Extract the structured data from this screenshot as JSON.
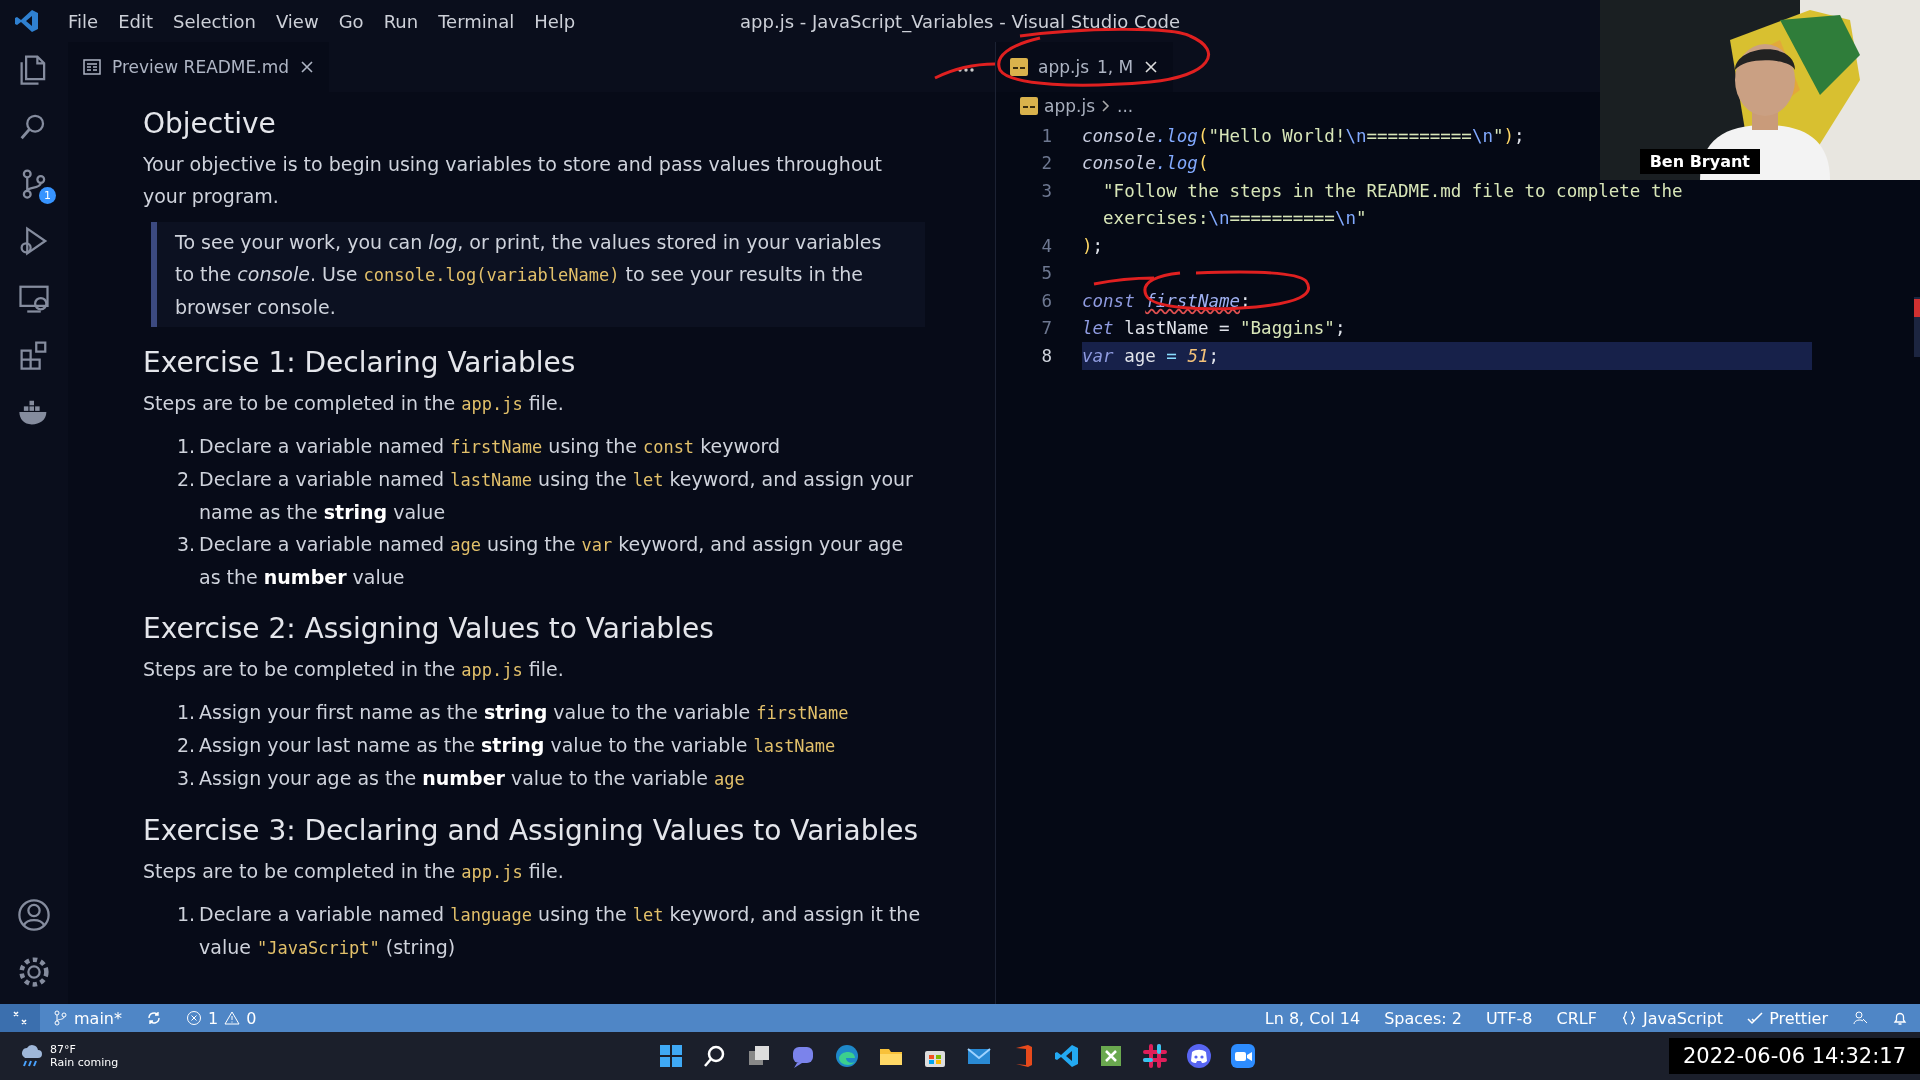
{
  "title_bar": {
    "menu": [
      "File",
      "Edit",
      "Selection",
      "View",
      "Go",
      "Run",
      "Terminal",
      "Help"
    ],
    "title": "app.js - JavaScript_Variables - Visual Studio Code"
  },
  "activity_bar": {
    "top": [
      {
        "kind": "files",
        "selected": false
      },
      {
        "kind": "search",
        "selected": false
      },
      {
        "kind": "scm",
        "selected": false,
        "badge": "1"
      },
      {
        "kind": "debug",
        "selected": false
      },
      {
        "kind": "remote",
        "selected": false
      },
      {
        "kind": "extensions",
        "selected": false
      },
      {
        "kind": "docker",
        "selected": false
      }
    ],
    "bottom": [
      {
        "kind": "account"
      },
      {
        "kind": "settings"
      }
    ]
  },
  "preview": {
    "tab": {
      "label": "Preview README.md",
      "selected": true
    },
    "blocks": [
      {
        "kind": "h2",
        "text": "Objective"
      },
      {
        "kind": "p",
        "segments": [
          {
            "kind": "text",
            "text": "Your objective is to begin using variables to store and pass values throughout your program."
          }
        ]
      },
      {
        "kind": "quote",
        "segments": [
          {
            "kind": "text",
            "text": "To see your work, you can "
          },
          {
            "kind": "italic",
            "text": "log"
          },
          {
            "kind": "text",
            "text": ", or print, the values stored in your variables to the "
          },
          {
            "kind": "italic",
            "text": "console"
          },
          {
            "kind": "text",
            "text": ". Use "
          },
          {
            "kind": "code",
            "text": "console.log(variableName)"
          },
          {
            "kind": "text",
            "text": " to see your results in the browser console."
          }
        ]
      },
      {
        "kind": "h2",
        "text": "Exercise 1: Declaring Variables"
      },
      {
        "kind": "p",
        "segments": [
          {
            "kind": "text",
            "text": "Steps are to be completed in the "
          },
          {
            "kind": "code",
            "text": "app.js"
          },
          {
            "kind": "text",
            "text": " file."
          }
        ]
      },
      {
        "kind": "ol",
        "items": [
          {
            "number": "1.",
            "segments": [
              {
                "kind": "text",
                "text": "Declare a variable named "
              },
              {
                "kind": "code",
                "text": "firstName"
              },
              {
                "kind": "text",
                "text": " using the "
              },
              {
                "kind": "code",
                "text": "const"
              },
              {
                "kind": "text",
                "text": " keyword"
              }
            ]
          },
          {
            "number": "2.",
            "segments": [
              {
                "kind": "text",
                "text": "Declare a variable named "
              },
              {
                "kind": "code",
                "text": "lastName"
              },
              {
                "kind": "text",
                "text": " using the "
              },
              {
                "kind": "code",
                "text": "let"
              },
              {
                "kind": "text",
                "text": " keyword, and assign your name as the "
              },
              {
                "kind": "bold",
                "text": "string"
              },
              {
                "kind": "text",
                "text": " value"
              }
            ]
          },
          {
            "number": "3.",
            "segments": [
              {
                "kind": "text",
                "text": "Declare a variable named "
              },
              {
                "kind": "code",
                "text": "age"
              },
              {
                "kind": "text",
                "text": " using the "
              },
              {
                "kind": "code",
                "text": "var"
              },
              {
                "kind": "text",
                "text": " keyword, and assign your age as the "
              },
              {
                "kind": "bold",
                "text": "number"
              },
              {
                "kind": "text",
                "text": " value"
              }
            ]
          }
        ]
      },
      {
        "kind": "h2",
        "text": "Exercise 2: Assigning Values to Variables"
      },
      {
        "kind": "p",
        "segments": [
          {
            "kind": "text",
            "text": "Steps are to be completed in the "
          },
          {
            "kind": "code",
            "text": "app.js"
          },
          {
            "kind": "text",
            "text": " file."
          }
        ]
      },
      {
        "kind": "ol",
        "items": [
          {
            "number": "1.",
            "segments": [
              {
                "kind": "text",
                "text": "Assign your first name as the "
              },
              {
                "kind": "bold",
                "text": "string"
              },
              {
                "kind": "text",
                "text": " value to the variable "
              },
              {
                "kind": "code",
                "text": "firstName"
              }
            ]
          },
          {
            "number": "2.",
            "segments": [
              {
                "kind": "text",
                "text": "Assign your last name as the "
              },
              {
                "kind": "bold",
                "text": "string"
              },
              {
                "kind": "text",
                "text": " value to the variable "
              },
              {
                "kind": "code",
                "text": "lastName"
              }
            ]
          },
          {
            "number": "3.",
            "segments": [
              {
                "kind": "text",
                "text": "Assign your age as the "
              },
              {
                "kind": "bold",
                "text": "number"
              },
              {
                "kind": "text",
                "text": " value to the variable "
              },
              {
                "kind": "code",
                "text": "age"
              }
            ]
          }
        ]
      },
      {
        "kind": "h2",
        "text": "Exercise 3: Declaring and Assigning Values to Variables"
      },
      {
        "kind": "p",
        "segments": [
          {
            "kind": "text",
            "text": "Steps are to be completed in the "
          },
          {
            "kind": "code",
            "text": "app.js"
          },
          {
            "kind": "text",
            "text": " file."
          }
        ]
      },
      {
        "kind": "ol",
        "items": [
          {
            "number": "1.",
            "segments": [
              {
                "kind": "text",
                "text": "Declare a variable named "
              },
              {
                "kind": "code",
                "text": "language"
              },
              {
                "kind": "text",
                "text": " using the "
              },
              {
                "kind": "code",
                "text": "let"
              },
              {
                "kind": "text",
                "text": " keyword, and assign it the value "
              },
              {
                "kind": "code",
                "text": "\"JavaScript\""
              },
              {
                "kind": "text",
                "text": " (string)"
              }
            ]
          }
        ]
      }
    ]
  },
  "editor": {
    "tab": {
      "label": "app.js",
      "badge": "1, M",
      "selected": true
    },
    "breadcrumb": [
      "app.js",
      "..."
    ],
    "lines": [
      {
        "number": "1",
        "current": false,
        "tokens": [
          {
            "kind": "obj",
            "text": "console"
          },
          {
            "kind": "fn",
            "text": ".log"
          },
          {
            "kind": "punct",
            "text": "("
          },
          {
            "kind": "string",
            "text": "\"Hello World!"
          },
          {
            "kind": "escape",
            "text": "\\n"
          },
          {
            "kind": "string",
            "text": "=========="
          },
          {
            "kind": "escape",
            "text": "\\n"
          },
          {
            "kind": "string",
            "text": "\""
          },
          {
            "kind": "punct",
            "text": ")"
          },
          {
            "kind": "plain",
            "text": ";"
          }
        ]
      },
      {
        "number": "2",
        "current": false,
        "tokens": [
          {
            "kind": "obj",
            "text": "console"
          },
          {
            "kind": "fn",
            "text": ".log"
          },
          {
            "kind": "punct",
            "text": "("
          }
        ]
      },
      {
        "number": "3",
        "current": false,
        "tokens": [
          {
            "kind": "string",
            "text": "  \"Follow the steps in the README.md file to complete the"
          }
        ]
      },
      {
        "current": false,
        "tokens": [
          {
            "kind": "string",
            "text": "  exercises:"
          },
          {
            "kind": "escape",
            "text": "\\n"
          },
          {
            "kind": "string",
            "text": "=========="
          },
          {
            "kind": "escape",
            "text": "\\n"
          },
          {
            "kind": "string",
            "text": "\""
          }
        ]
      },
      {
        "number": "4",
        "current": false,
        "tokens": [
          {
            "kind": "punct",
            "text": ")"
          },
          {
            "kind": "plain",
            "text": ";"
          }
        ]
      },
      {
        "number": "5",
        "current": false
      },
      {
        "number": "6",
        "current": false,
        "tokens": [
          {
            "kind": "keyword",
            "text": "const "
          },
          {
            "kind": "error",
            "text": "firstName"
          },
          {
            "kind": "plain",
            "text": ";"
          }
        ]
      },
      {
        "number": "7",
        "current": false,
        "tokens": [
          {
            "kind": "keyword",
            "text": "let"
          },
          {
            "kind": "plain",
            "text": " lastName = "
          },
          {
            "kind": "string",
            "text": "\"Baggins\""
          },
          {
            "kind": "plain",
            "text": ";"
          }
        ]
      },
      {
        "number": "8",
        "current": true,
        "tokens": [
          {
            "kind": "keyword",
            "text": "var"
          },
          {
            "kind": "plain",
            "text": " age "
          },
          {
            "kind": "op",
            "text": "="
          },
          {
            "kind": "number",
            "text": " 51"
          },
          {
            "kind": "plain",
            "text": ";"
          }
        ]
      }
    ]
  },
  "webcam": {
    "kind": "picture",
    "name": "Ben Bryant"
  },
  "status_bar": {
    "branch": "main*",
    "errors": "1",
    "warnings": "0",
    "right": [
      {
        "kind": "text",
        "text": "Ln 8, Col 14"
      },
      {
        "kind": "text",
        "text": "Spaces: 2"
      },
      {
        "kind": "text",
        "text": "UTF-8"
      },
      {
        "kind": "text",
        "text": "CRLF"
      },
      {
        "kind": "language",
        "text": "JavaScript"
      },
      {
        "kind": "check",
        "text": "Prettier"
      }
    ]
  },
  "taskbar": {
    "weather": {
      "temp": "87°F",
      "text": "Rain coming"
    },
    "apps": [
      {
        "kind": "start"
      },
      {
        "kind": "search"
      },
      {
        "kind": "taskview"
      },
      {
        "kind": "chat"
      },
      {
        "kind": "edge"
      },
      {
        "kind": "explorer"
      },
      {
        "kind": "store"
      },
      {
        "kind": "mail"
      },
      {
        "kind": "office"
      },
      {
        "kind": "vscode"
      },
      {
        "kind": "excel"
      },
      {
        "kind": "slack"
      },
      {
        "kind": "discord"
      },
      {
        "kind": "zoom"
      }
    ],
    "clock": "2022-06-06 14:32:17"
  }
}
